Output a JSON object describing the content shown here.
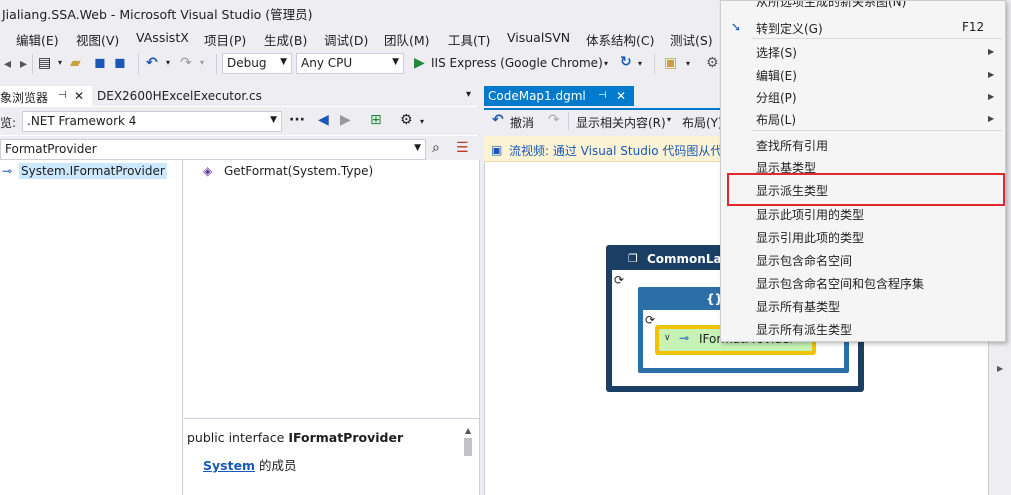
{
  "window": {
    "title": "Jialiang.SSA.Web - Microsoft Visual Studio (管理员)"
  },
  "menu": [
    "编辑(E)",
    "视图(V)",
    "VAssistX",
    "项目(P)",
    "生成(B)",
    "调试(D)",
    "团队(M)",
    "工具(T)",
    "VisualSVN",
    "体系结构(C)",
    "测试(S)"
  ],
  "toolbar": {
    "config": "Debug",
    "platform": "Any CPU",
    "run_target": "IIS Express (Google Chrome)"
  },
  "left_pane": {
    "tabs": [
      "象浏览器",
      "DEX2600HExcelExecutor.cs"
    ],
    "browse_label": "览:",
    "browse_value": ".NET Framework 4",
    "search_value": "FormatProvider",
    "type_item": {
      "prefix": "System.",
      "name": "IFormatProvider"
    },
    "member_item": "GetFormat(System.Type)",
    "desc_signature_prefix": "public interface ",
    "desc_signature_name": "IFormatProvider",
    "desc_link": "System",
    "desc_suffix": " 的成员"
  },
  "editor": {
    "tab": "CodeMap1.dgml",
    "toolbar": {
      "undo": "撤消",
      "show_related": "显示相关内容(R)",
      "layout": "布局(Y)"
    },
    "info_bar": "流视频: 通过 Visual Studio 代码图从代",
    "nodes": {
      "outer": "CommonLan",
      "mid": "{}",
      "leaf": "IFormatProvider"
    }
  },
  "context_menu": {
    "top_partial": "从所选项生成的新关系图(N)",
    "items": [
      {
        "label": "转到定义(G)",
        "shortcut": "F12",
        "submenu": false
      },
      {
        "label": "选择(S)",
        "shortcut": "",
        "submenu": true
      },
      {
        "label": "编辑(E)",
        "shortcut": "",
        "submenu": true
      },
      {
        "label": "分组(P)",
        "shortcut": "",
        "submenu": true
      },
      {
        "label": "布局(L)",
        "shortcut": "",
        "submenu": true
      },
      {
        "label": "查找所有引用",
        "shortcut": "",
        "submenu": false
      },
      {
        "label": "显示基类型",
        "shortcut": "",
        "submenu": false
      },
      {
        "label": "显示派生类型",
        "shortcut": "",
        "submenu": false
      },
      {
        "label": "显示此项引用的类型",
        "shortcut": "",
        "submenu": false
      },
      {
        "label": "显示引用此项的类型",
        "shortcut": "",
        "submenu": false
      },
      {
        "label": "显示包含命名空间",
        "shortcut": "",
        "submenu": false
      },
      {
        "label": "显示包含命名空间和包含程序集",
        "shortcut": "",
        "submenu": false
      },
      {
        "label": "显示所有基类型",
        "shortcut": "",
        "submenu": false
      },
      {
        "label": "显示所有派生类型",
        "shortcut": "",
        "submenu": false
      }
    ]
  },
  "colors": {
    "accent": "#007acc",
    "highlight": "#e0282d",
    "leaf_fill": "#c6f3b5",
    "leaf_border": "#f2c400"
  }
}
